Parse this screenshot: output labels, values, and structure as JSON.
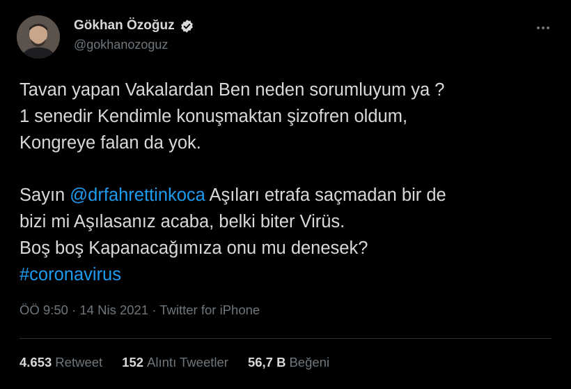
{
  "colors": {
    "background": "#000000",
    "text": "#d9d9d9",
    "secondary": "#6e767d",
    "link": "#1d9bf0",
    "divider": "#2f3336"
  },
  "author": {
    "display_name": "Gökhan Özoğuz",
    "handle": "@gokhanozoguz",
    "verified": true,
    "avatar_icon": "profile-photo"
  },
  "tweet": {
    "lines": [
      "Tavan yapan Vakalardan Ben neden sorumluyum ya ?",
      "1 senedir Kendimle konuşmaktan şizofren oldum,",
      "Kongreye falan da yok."
    ],
    "para2_prefix": "Sayın ",
    "mention": "@drfahrettinkoca",
    "para2_suffix": " Aşıları etrafa saçmadan bir de",
    "para2_line2": "bizi mi Aşılasanız acaba, belki biter Virüs.",
    "para2_line3": "Boş boş Kapanacağımıza onu mu denesek?",
    "hashtag": "#coronavirus"
  },
  "meta": {
    "time": "ÖÖ 9:50",
    "separator": " · ",
    "date": "14 Nis 2021",
    "source": "Twitter for iPhone"
  },
  "stats": {
    "retweets_count": "4.653",
    "retweets_label": "Retweet",
    "quotes_count": "152",
    "quotes_label": "Alıntı Tweetler",
    "likes_count": "56,7 B",
    "likes_label": "Beğeni"
  }
}
